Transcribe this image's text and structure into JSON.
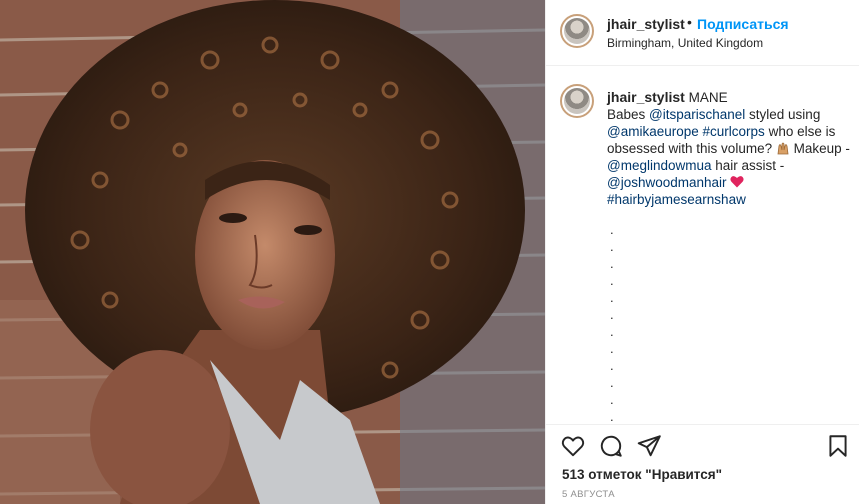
{
  "photo": {
    "alt": ""
  },
  "post": {
    "username": "jhair_stylist",
    "separator": "•",
    "follow_label": "Подписаться",
    "location": "Birmingham, United Kingdom"
  },
  "caption": {
    "username": "jhair_stylist",
    "text_1": " MANE",
    "text_2": "Babes ",
    "mention_1": "@itsparischanel",
    "text_3": " styled using ",
    "mention_2": "@amikaeurope",
    "text_4": " ",
    "hashtag_1": "#curlcorps",
    "text_5": " who else is obsessed with this volume? ",
    "text_6": " Makeup - ",
    "mention_3": "@meglindowmua",
    "text_7": " hair assist - ",
    "mention_4": "@joshwoodmanhair",
    "hashtag_2": "#hairbyjamesearnshaw",
    "dot_lines": [
      ".",
      ".",
      ".",
      ".",
      ".",
      ".",
      ".",
      ".",
      ".",
      ".",
      ".",
      "."
    ]
  },
  "actions": {
    "likes": "513 отметок \"Нравится\"",
    "date": "5 АВГУСТА"
  },
  "icons": {
    "like": "heart-outline-icon",
    "comment": "comment-bubble-icon",
    "share": "paper-plane-icon",
    "save": "bookmark-icon"
  },
  "colors": {
    "follow": "#0095f6",
    "link": "#00376b",
    "secondary_text": "#8e8e8e",
    "heart_emoji": "#e0245e"
  }
}
